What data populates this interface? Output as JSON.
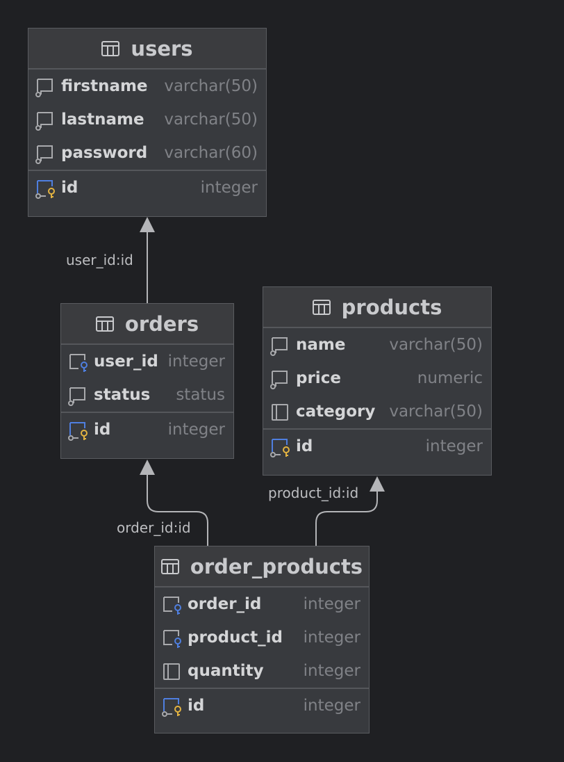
{
  "colors": {
    "background": "#1f2023",
    "table_body": "#383a3e",
    "table_header": "#3b3c3f",
    "border": "#5a5c60",
    "name_text": "#d4d5d7",
    "type_text": "#808287",
    "connector": "#b4b5b8",
    "fk_icon": "#4f7fe0",
    "pk_icon": "#e3b341"
  },
  "tables": {
    "users": {
      "title": "users",
      "columns": [
        {
          "name": "firstname",
          "type": "varchar(50)",
          "icon": "column-icon"
        },
        {
          "name": "lastname",
          "type": "varchar(50)",
          "icon": "column-icon"
        },
        {
          "name": "password",
          "type": "varchar(60)",
          "icon": "column-icon"
        }
      ],
      "pk": {
        "name": "id",
        "type": "integer",
        "icon": "primary-key-icon"
      }
    },
    "orders": {
      "title": "orders",
      "columns": [
        {
          "name": "user_id",
          "type": "integer",
          "icon": "foreign-key-icon"
        },
        {
          "name": "status",
          "type": "status",
          "icon": "column-icon"
        }
      ],
      "pk": {
        "name": "id",
        "type": "integer",
        "icon": "primary-key-icon"
      }
    },
    "products": {
      "title": "products",
      "columns": [
        {
          "name": "name",
          "type": "varchar(50)",
          "icon": "column-icon"
        },
        {
          "name": "price",
          "type": "numeric",
          "icon": "column-icon"
        },
        {
          "name": "category",
          "type": "varchar(50)",
          "icon": "nullable-column-icon"
        }
      ],
      "pk": {
        "name": "id",
        "type": "integer",
        "icon": "primary-key-icon"
      }
    },
    "order_products": {
      "title": "order_products",
      "columns": [
        {
          "name": "order_id",
          "type": "integer",
          "icon": "foreign-key-icon"
        },
        {
          "name": "product_id",
          "type": "integer",
          "icon": "foreign-key-icon"
        },
        {
          "name": "quantity",
          "type": "integer",
          "icon": "nullable-column-icon"
        }
      ],
      "pk": {
        "name": "id",
        "type": "integer",
        "icon": "primary-key-icon"
      }
    }
  },
  "relations": [
    {
      "label": "user_id:id",
      "from": "orders",
      "to": "users"
    },
    {
      "label": "order_id:id",
      "from": "order_products",
      "to": "orders"
    },
    {
      "label": "product_id:id",
      "from": "order_products",
      "to": "products"
    }
  ]
}
